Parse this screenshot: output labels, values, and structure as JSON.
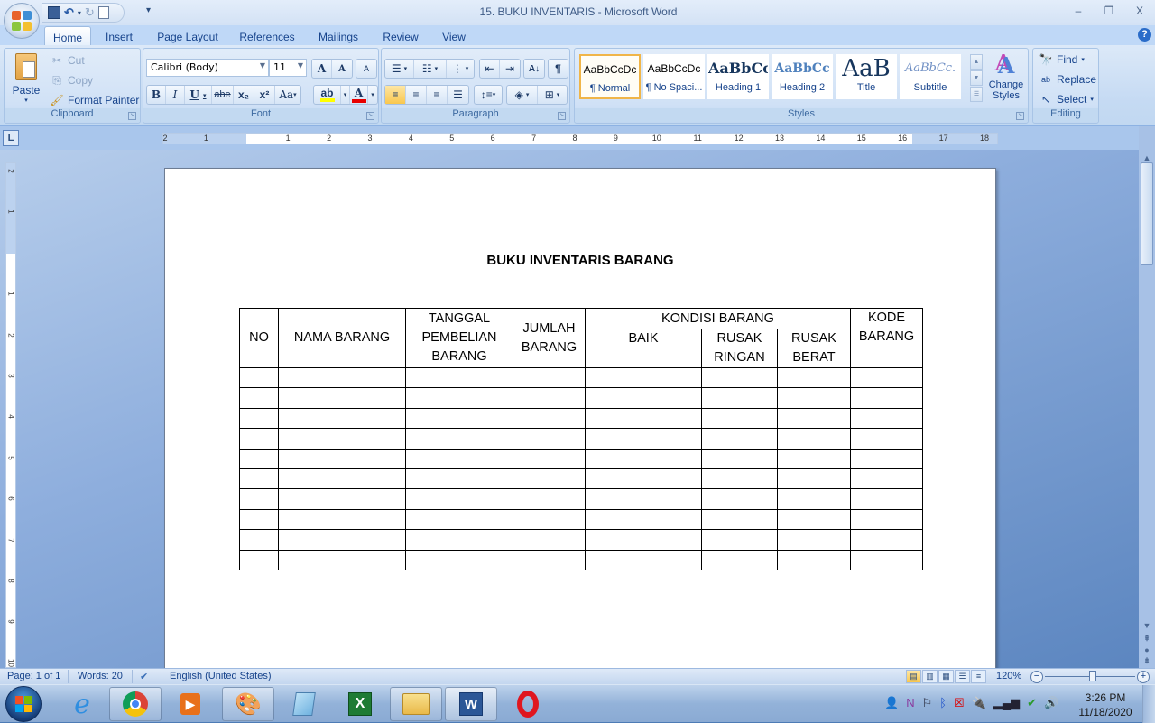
{
  "window": {
    "title": "15. BUKU INVENTARIS - Microsoft Word",
    "controls": {
      "minimize": "–",
      "restore": "❐",
      "close": "X"
    }
  },
  "quick_access": {
    "save_icon": "💾",
    "undo_icon": "↶",
    "redo_icon": "↻",
    "more_icon": "▾"
  },
  "tabs": [
    {
      "label": "Home",
      "active": true
    },
    {
      "label": "Insert"
    },
    {
      "label": "Page Layout"
    },
    {
      "label": "References"
    },
    {
      "label": "Mailings"
    },
    {
      "label": "Review"
    },
    {
      "label": "View"
    }
  ],
  "help_icon": "?",
  "ribbon": {
    "clipboard": {
      "label": "Clipboard",
      "paste": "Paste",
      "cut": "Cut",
      "copy": "Copy",
      "format_painter": "Format Painter"
    },
    "font": {
      "label": "Font",
      "font_name": "Calibri (Body)",
      "font_size": "11",
      "grow": "A",
      "shrink": "A",
      "clear": "A",
      "bold": "B",
      "italic": "I",
      "underline": "U",
      "strike": "abe",
      "subscript": "x₂",
      "superscript": "x²",
      "change_case": "Aa",
      "highlight": "ab",
      "font_color": "A",
      "highlight_color": "#ffff00",
      "font_color_value": "#e80000"
    },
    "paragraph": {
      "label": "Paragraph",
      "show_marks": "¶",
      "sort": "A↓"
    },
    "styles": {
      "label": "Styles",
      "items": [
        {
          "preview": "AaBbCcDc",
          "name": "¶ Normal",
          "selected": true
        },
        {
          "preview": "AaBbCcDc",
          "name": "¶ No Spaci..."
        },
        {
          "preview": "AaBbCc",
          "name": "Heading 1"
        },
        {
          "preview": "AaBbCc",
          "name": "Heading 2"
        },
        {
          "preview": "AaB",
          "name": "Title"
        },
        {
          "preview": "AaBbCc.",
          "name": "Subtitle"
        }
      ],
      "change_styles": "Change Styles"
    },
    "editing": {
      "label": "Editing",
      "find": "Find",
      "replace": "Replace",
      "select": "Select"
    }
  },
  "ruler": {
    "horizontal": [
      "2",
      "1",
      "",
      "1",
      "2",
      "3",
      "4",
      "5",
      "6",
      "7",
      "8",
      "9",
      "10",
      "11",
      "12",
      "13",
      "14",
      "15",
      "16",
      "17",
      "18"
    ],
    "vertical": [
      "2",
      "1",
      "",
      "1",
      "2",
      "3",
      "4",
      "5",
      "6",
      "7",
      "8",
      "9",
      "10"
    ]
  },
  "document": {
    "title": "BUKU INVENTARIS BARANG",
    "table": {
      "headers": {
        "no": "NO",
        "nama_barang": "NAMA BARANG",
        "tanggal_pembelian": "TANGGAL PEMBELIAN BARANG",
        "jumlah_barang": "JUMLAH BARANG",
        "kondisi_barang": "KONDISI BARANG",
        "baik": "BAIK",
        "rusak_ringan": "RUSAK RINGAN",
        "rusak_berat": "RUSAK BERAT",
        "kode_barang": "KODE BARANG"
      },
      "rows": [
        [
          "",
          "",
          "",
          "",
          "",
          "",
          "",
          ""
        ],
        [
          "",
          "",
          "",
          "",
          "",
          "",
          "",
          ""
        ],
        [
          "",
          "",
          "",
          "",
          "",
          "",
          "",
          ""
        ],
        [
          "",
          "",
          "",
          "",
          "",
          "",
          "",
          ""
        ],
        [
          "",
          "",
          "",
          "",
          "",
          "",
          "",
          ""
        ],
        [
          "",
          "",
          "",
          "",
          "",
          "",
          "",
          ""
        ],
        [
          "",
          "",
          "",
          "",
          "",
          "",
          "",
          ""
        ],
        [
          "",
          "",
          "",
          "",
          "",
          "",
          "",
          ""
        ],
        [
          "",
          "",
          "",
          "",
          "",
          "",
          "",
          ""
        ],
        [
          "",
          "",
          "",
          "",
          "",
          "",
          "",
          ""
        ]
      ]
    }
  },
  "status": {
    "page": "Page: 1 of 1",
    "words": "Words: 20",
    "language": "English (United States)",
    "zoom": "120%",
    "zoom_percent": 120
  },
  "taskbar": {
    "apps": [
      {
        "name": "internet-explorer",
        "glyph": "e"
      },
      {
        "name": "chrome",
        "glyph": "◉"
      },
      {
        "name": "media-player",
        "glyph": "▶"
      },
      {
        "name": "paint",
        "glyph": "🎨"
      },
      {
        "name": "notepad",
        "glyph": "▤"
      },
      {
        "name": "excel",
        "glyph": "X"
      },
      {
        "name": "explorer",
        "glyph": "📁"
      },
      {
        "name": "word",
        "glyph": "W"
      },
      {
        "name": "opera",
        "glyph": "O"
      }
    ],
    "clock_time": "3:26 PM",
    "clock_date": "11/18/2020"
  }
}
